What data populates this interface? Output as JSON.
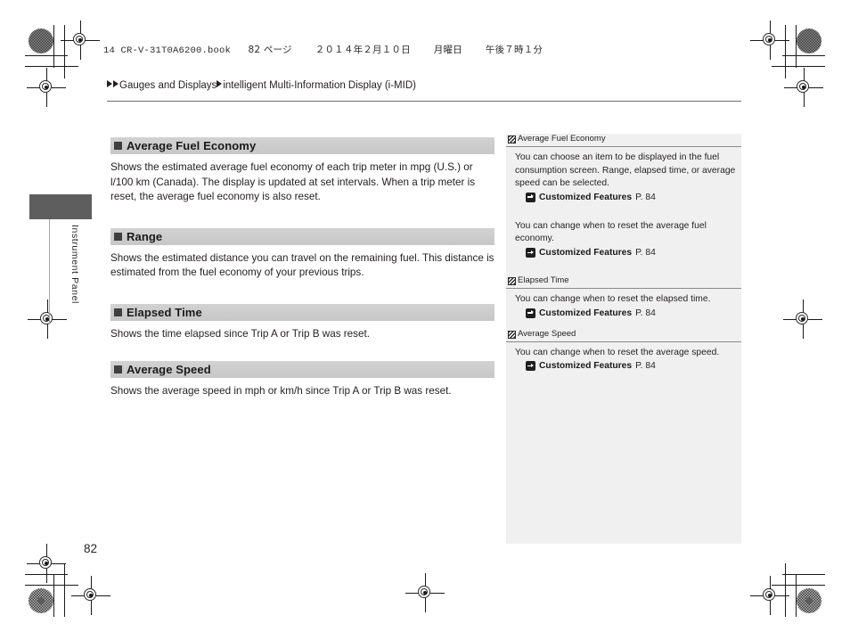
{
  "book_header": {
    "file": "14 CR-V-31T0A6200.book",
    "page_marker": "82 ページ",
    "date": "２０１４年２月１０日",
    "weekday": "月曜日",
    "time": "午後７時１分"
  },
  "breadcrumb": {
    "level1": "Gauges and Displays",
    "level2": "intelligent Multi-Information Display (i-MID)"
  },
  "thumb_tab": {
    "label": "Instrument Panel"
  },
  "folio": {
    "page_number": "82"
  },
  "main": {
    "sections": [
      {
        "heading": "Average Fuel Economy",
        "body": "Shows the estimated average fuel economy of each trip meter in mpg (U.S.) or l/100 km (Canada). The display is updated at set intervals. When a trip meter is reset, the average fuel economy is also reset."
      },
      {
        "heading": "Range",
        "body": "Shows the estimated distance you can travel on the remaining fuel. This distance is estimated from the fuel economy of your previous trips."
      },
      {
        "heading": "Elapsed Time",
        "body": "Shows the time elapsed since Trip A or Trip B was reset."
      },
      {
        "heading": "Average Speed",
        "body": "Shows the average speed in mph or km/h since Trip A or Trip B was reset."
      }
    ]
  },
  "reference_panel": {
    "blocks": [
      {
        "title": "Average Fuel Economy",
        "body": "You can choose an item to be displayed in the fuel consumption screen. Range, elapsed time, or average speed can be selected.",
        "link_label": "Customized Features",
        "link_page": "P. 84"
      },
      {
        "body": "You can change when to reset the average fuel economy.",
        "link_label": "Customized Features",
        "link_page": "P. 84"
      },
      {
        "title": "Elapsed Time",
        "body": "You can change when to reset the elapsed time.",
        "link_label": "Customized Features",
        "link_page": "P. 84"
      },
      {
        "title": "Average Speed",
        "body": "You can change when to reset the average speed.",
        "link_label": "Customized Features",
        "link_page": "P. 84"
      }
    ]
  },
  "colors": {
    "section_heading_bg": "#cbcbcb",
    "reference_panel_bg": "#f0f0f0",
    "tab_block": "#5e5e5e",
    "text": "#231f20"
  }
}
